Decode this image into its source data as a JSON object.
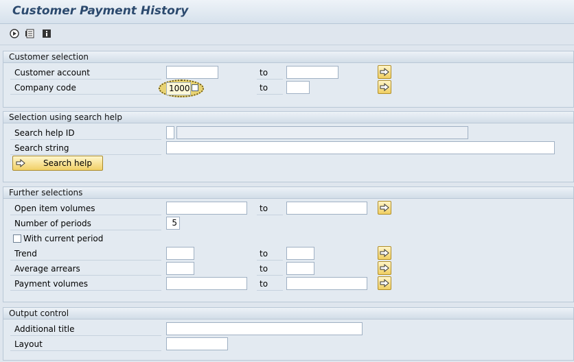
{
  "title": "Customer Payment History",
  "toolbar": {
    "icons": [
      "execute-icon",
      "variant-icon",
      "info-icon"
    ]
  },
  "customer_selection": {
    "header": "Customer selection",
    "rows": [
      {
        "label": "Customer account",
        "from": "",
        "to_label": "to",
        "to": ""
      },
      {
        "label": "Company code",
        "from": "1000",
        "to_label": "to",
        "to": ""
      }
    ]
  },
  "search_help": {
    "header": "Selection using search help",
    "id_label": "Search help ID",
    "id_value": "",
    "id_desc": "",
    "string_label": "Search string",
    "string_value": "",
    "button_label": "Search help"
  },
  "further": {
    "header": "Further selections",
    "open_items": {
      "label": "Open item volumes",
      "from": "",
      "to_label": "to",
      "to": ""
    },
    "periods": {
      "label": "Number of periods",
      "value": "5"
    },
    "current_period": {
      "label": "With current period",
      "checked": false
    },
    "trend": {
      "label": "Trend",
      "from": "",
      "to_label": "to",
      "to": ""
    },
    "arrears": {
      "label": "Average arrears",
      "from": "",
      "to_label": "to",
      "to": ""
    },
    "payments": {
      "label": "Payment volumes",
      "from": "",
      "to_label": "to",
      "to": ""
    }
  },
  "output": {
    "header": "Output control",
    "title_label": "Additional title",
    "title_value": "",
    "layout_label": "Layout",
    "layout_value": ""
  },
  "colors": {
    "accent": "#2c4a6e",
    "button": "#f0cf62",
    "background": "#dfe6ee"
  }
}
